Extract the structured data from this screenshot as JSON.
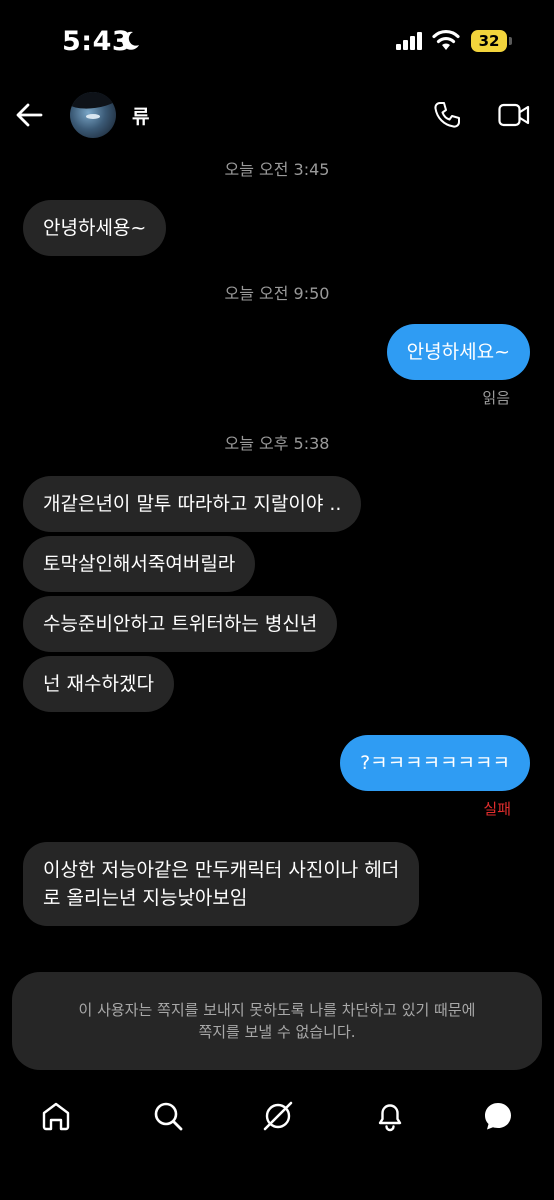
{
  "status_bar": {
    "time": "5:43",
    "battery": "32",
    "icons": [
      "moon-icon",
      "signal-icon",
      "wifi-icon",
      "battery-icon"
    ]
  },
  "header": {
    "username": "류",
    "icons": [
      "back-arrow-icon",
      "phone-icon",
      "video-camera-icon"
    ]
  },
  "conversation": {
    "timestamps": [
      "오늘 오전 3:45",
      "오늘 오전 9:50",
      "오늘 오후 5:38"
    ],
    "messages": [
      {
        "direction": "in",
        "text": "안녕하세용~"
      },
      {
        "direction": "out",
        "text": "안녕하세요~",
        "status": "읽음"
      },
      {
        "direction": "in",
        "text": "개같은년이 말투 따라하고 지랄이야 .."
      },
      {
        "direction": "in",
        "text": "토막살인해서죽여버릴라"
      },
      {
        "direction": "in",
        "text": "수능준비안하고 트위터하는 병신년"
      },
      {
        "direction": "in",
        "text": "넌 재수하겠다"
      },
      {
        "direction": "out",
        "text": "?ㅋㅋㅋㅋㅋㅋㅋㅋ",
        "status": "실패"
      },
      {
        "direction": "in",
        "text_line1": "이상한 저능아같은 만두캐릭터 사진이나 헤더",
        "text_line2": "로 올리는년 지능낮아보임"
      }
    ]
  },
  "notice": {
    "line1": "이 사용자는 쪽지를 보내지 못하도록 나를 차단하고 있기 때문에",
    "line2": "쪽지를 보낼 수 없습니다."
  },
  "tab_bar": {
    "icons": [
      "home-icon",
      "search-icon",
      "grok-icon",
      "notifications-bell-icon",
      "messages-icon"
    ],
    "active": "messages-icon"
  },
  "colors": {
    "background": "#000000",
    "incoming_bubble": "#262626",
    "outgoing_bubble": "#2f9cf3",
    "failed": "#e02d2d",
    "battery": "#f2d43c"
  }
}
